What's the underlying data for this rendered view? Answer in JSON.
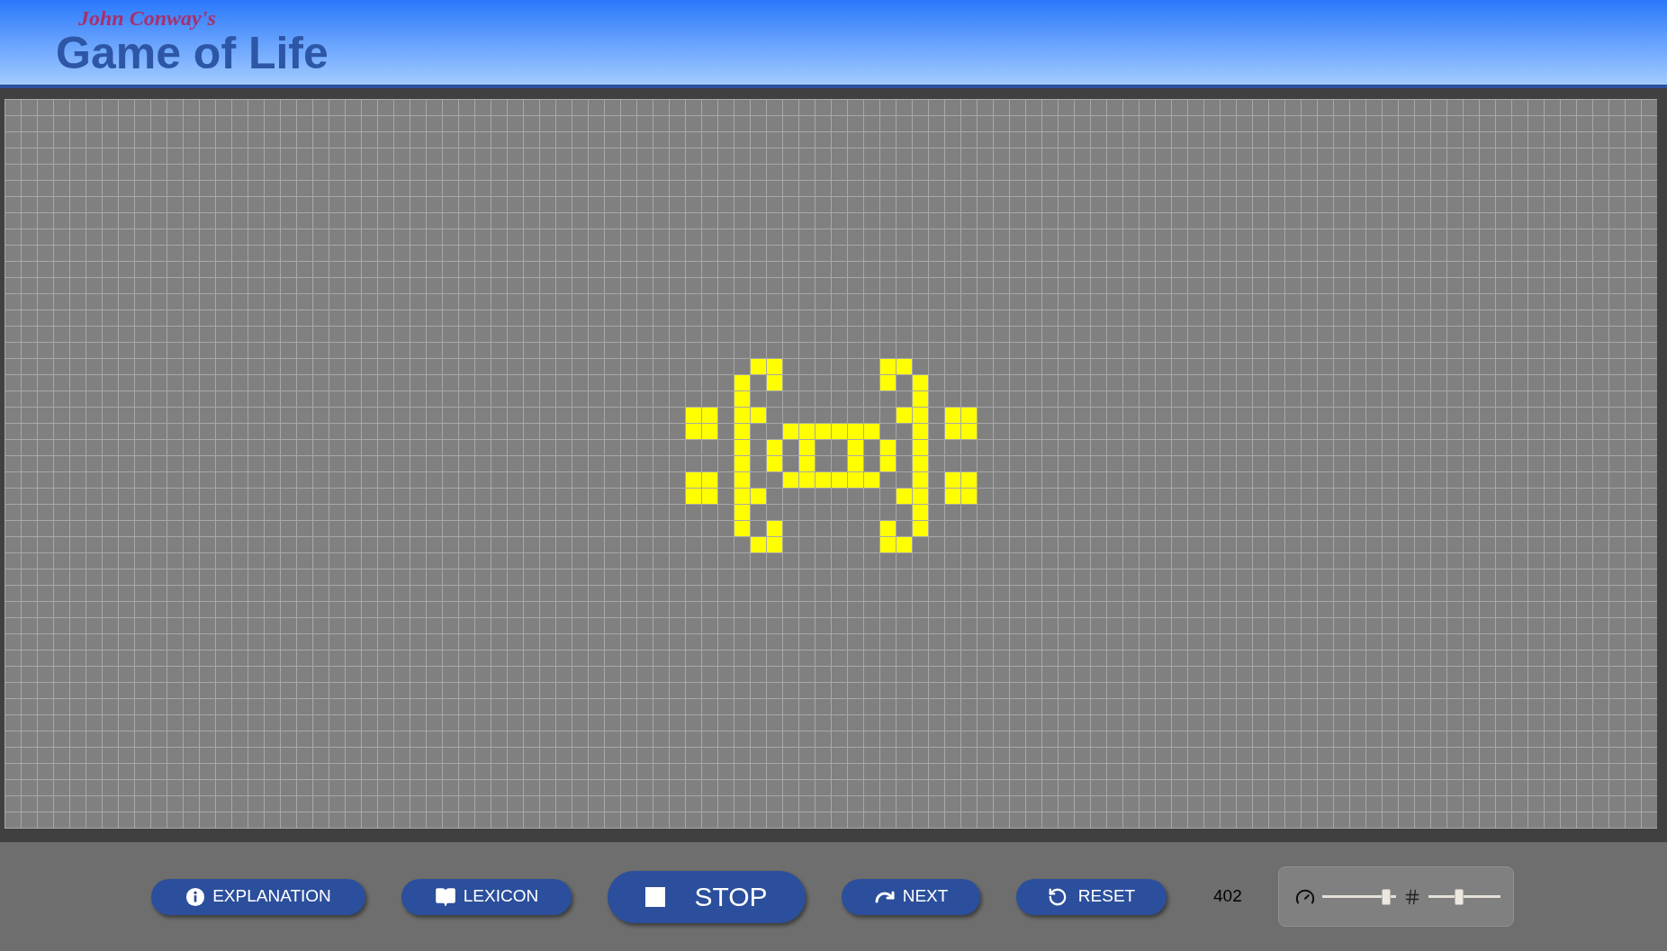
{
  "header": {
    "subtitle": "John Conway's",
    "title": "Game of Life"
  },
  "buttons": [
    {
      "kind": "info",
      "label": "EXPLANATION"
    },
    {
      "kind": "book",
      "label": "LEXICON"
    },
    {
      "kind": "stop",
      "label": "STOP"
    },
    {
      "kind": "next",
      "label": "NEXT"
    },
    {
      "kind": "reset",
      "label": "RESET"
    }
  ],
  "generation": "402",
  "sliders": [
    {
      "kind": "speed",
      "level": 0.92
    },
    {
      "kind": "size",
      "level": 0.42
    }
  ]
}
